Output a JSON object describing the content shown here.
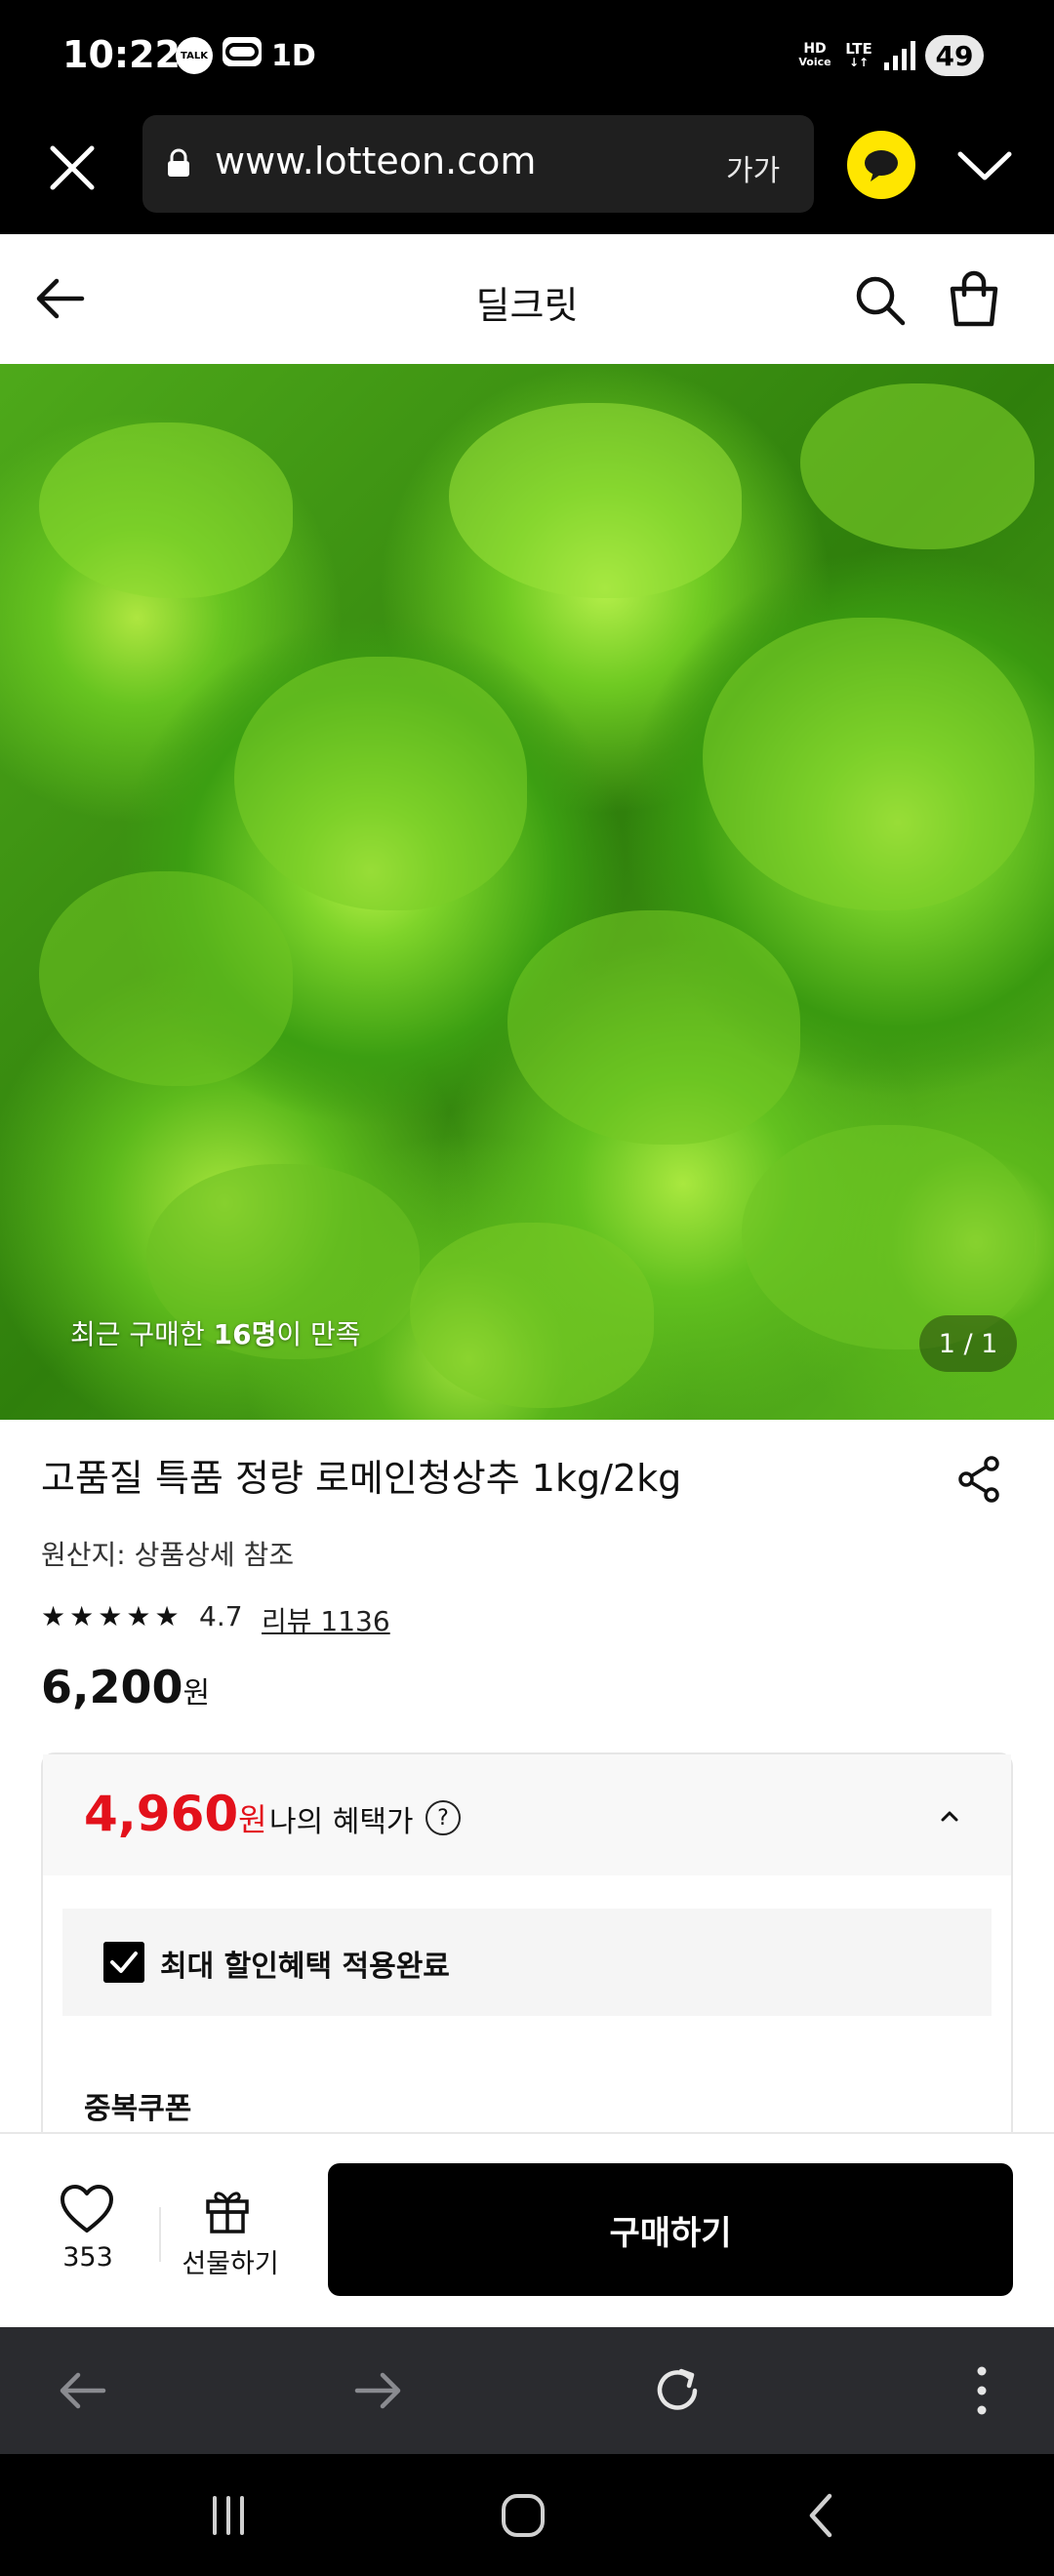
{
  "status_bar": {
    "time": "10:22",
    "talk_icon_text": "TALK",
    "extra_icon_text": "1D",
    "hd_voice": "HD",
    "voice": "Voice",
    "network": "LTE",
    "battery": "49"
  },
  "browser": {
    "url": "www.lotteon.com",
    "text_size_label": "가가"
  },
  "header": {
    "title": "딜크릿"
  },
  "hero": {
    "buyer_text_prefix": "최근 구매한 ",
    "buyer_count": "16명",
    "buyer_text_suffix": "이 만족",
    "pager": "1 / 1"
  },
  "product": {
    "title": "고품질 특품 정량 로메인청상추 1kg/2kg",
    "origin": "원산지: 상품상세 참조",
    "rating": "4.7",
    "stars": 4.7,
    "review_label": "리뷰 1136",
    "price": "6,200",
    "currency": "원"
  },
  "benefit": {
    "price": "4,960",
    "currency": "원",
    "label": "나의 혜택가",
    "help": "?",
    "applied_text": "최대 할인혜택 적용완료",
    "coupon_label": "중복쿠폰"
  },
  "actions": {
    "like_count": "353",
    "gift_label": "선물하기",
    "buy_label": "구매하기"
  },
  "colors": {
    "accent_red": "#e3111b",
    "kakao_yellow": "#ffe600",
    "buy_button": "#000000"
  }
}
